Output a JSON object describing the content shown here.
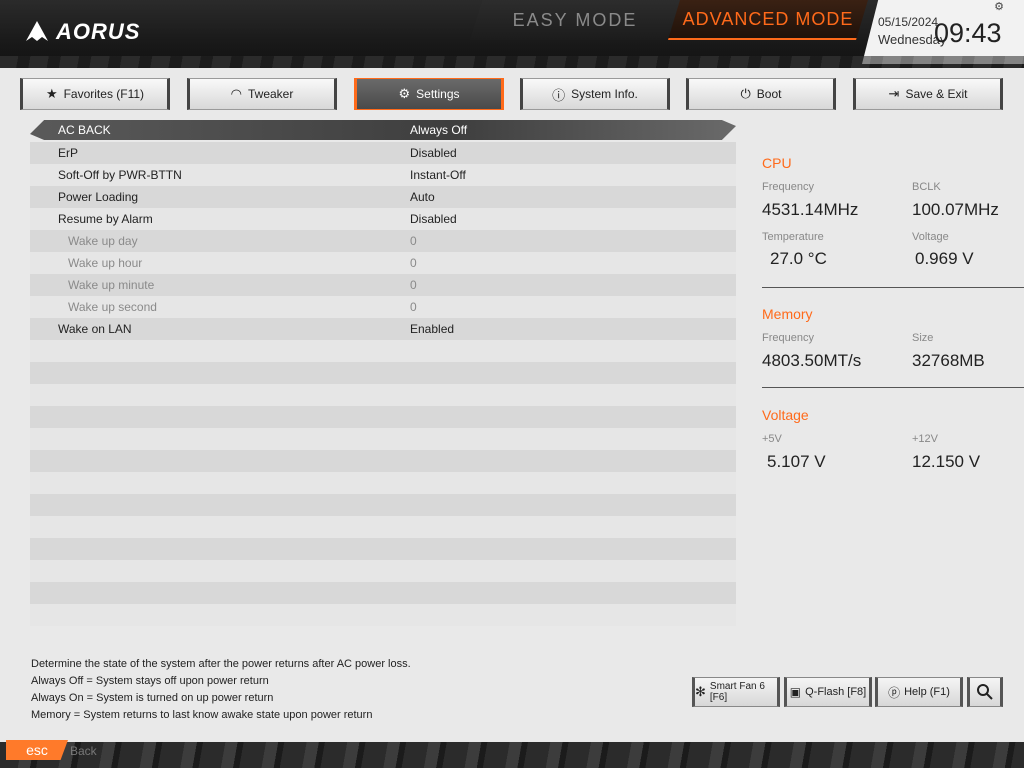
{
  "header": {
    "logo": "AORUS",
    "easy_mode": "EASY MODE",
    "advanced_mode": "ADVANCED MODE",
    "date": "05/15/2024",
    "day": "Wednesday",
    "time": "09:43"
  },
  "tabs": [
    {
      "label": "Favorites (F11)",
      "icon": "star-folder-icon"
    },
    {
      "label": "Tweaker",
      "icon": "gauge-icon"
    },
    {
      "label": "Settings",
      "icon": "gear-icon",
      "active": true
    },
    {
      "label": "System Info.",
      "icon": "info-icon"
    },
    {
      "label": "Boot",
      "icon": "power-icon"
    },
    {
      "label": "Save & Exit",
      "icon": "exit-icon"
    }
  ],
  "settings": [
    {
      "label": "AC BACK",
      "value": "Always Off"
    },
    {
      "label": "ErP",
      "value": "Disabled"
    },
    {
      "label": "Soft-Off by PWR-BTTN",
      "value": "Instant-Off"
    },
    {
      "label": "Power Loading",
      "value": "Auto"
    },
    {
      "label": "Resume by Alarm",
      "value": "Disabled"
    },
    {
      "label": "Wake up day",
      "value": "0"
    },
    {
      "label": "Wake up hour",
      "value": "0"
    },
    {
      "label": "Wake up minute",
      "value": "0"
    },
    {
      "label": "Wake up second",
      "value": "0"
    },
    {
      "label": "Wake on LAN",
      "value": "Enabled"
    }
  ],
  "panel": {
    "cpu": {
      "title": "CPU",
      "frequency_label": "Frequency",
      "frequency": "4531.14MHz",
      "bclk_label": "BCLK",
      "bclk": "100.07MHz",
      "temperature_label": "Temperature",
      "temperature": "27.0 °C",
      "voltage_label": "Voltage",
      "voltage": "0.969 V"
    },
    "memory": {
      "title": "Memory",
      "frequency_label": "Frequency",
      "frequency": "4803.50MT/s",
      "size_label": "Size",
      "size": "32768MB"
    },
    "voltage": {
      "title": "Voltage",
      "v5_label": "+5V",
      "v5": "5.107 V",
      "v12_label": "+12V",
      "v12": "12.150 V"
    }
  },
  "help": [
    "Determine the state of  the system after the power returns after AC power loss.",
    "Always Off = System stays off upon power return",
    "Always On = System is turned on up power return",
    "Memory = System returns to last know awake state upon power return"
  ],
  "buttons": {
    "smart_fan": "Smart Fan 6 [F6]",
    "qflash": "Q-Flash [F8]",
    "help": "Help (F1)"
  },
  "footer": {
    "esc": "esc",
    "back": "Back"
  },
  "colors": {
    "accent": "#ff6a1a",
    "header_bg": "#1a1a1a",
    "body_bg": "#e9e9e9"
  }
}
